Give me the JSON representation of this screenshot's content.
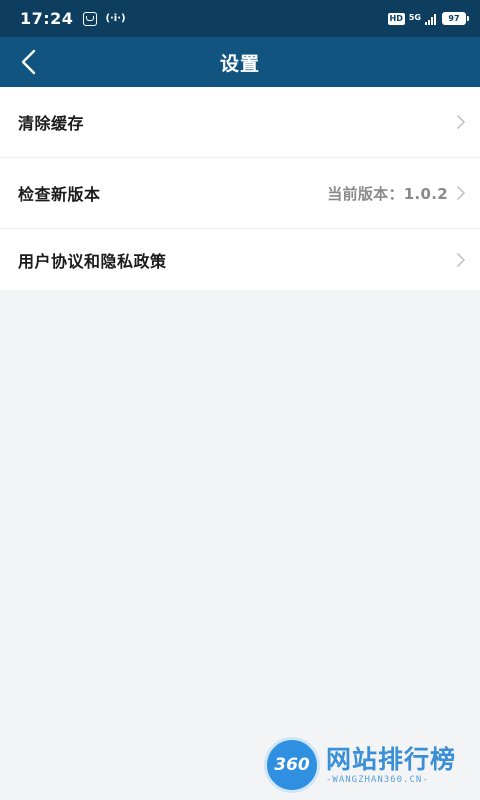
{
  "status_bar": {
    "time": "17:24",
    "hotspot_label": "(·i·)",
    "hd_label": "HD",
    "network_label": "5G",
    "battery_level": "97"
  },
  "nav": {
    "title": "设置",
    "back_icon": "chevron-left-icon"
  },
  "settings": {
    "items": [
      {
        "label": "清除缓存",
        "value": ""
      },
      {
        "label": "检查新版本",
        "value": "当前版本：1.0.2"
      },
      {
        "label": "用户协议和隐私政策",
        "value": ""
      }
    ]
  },
  "watermark": {
    "logo_text": "360",
    "title": "网站排行榜",
    "subtitle": "-WANGZHAN360.CN-"
  },
  "colors": {
    "status_bar_bg": "#0d3e60",
    "nav_bg": "#10547f",
    "page_bg": "#f3f4f6",
    "item_bg": "#ffffff",
    "secondary_text": "#8a8a8a"
  }
}
